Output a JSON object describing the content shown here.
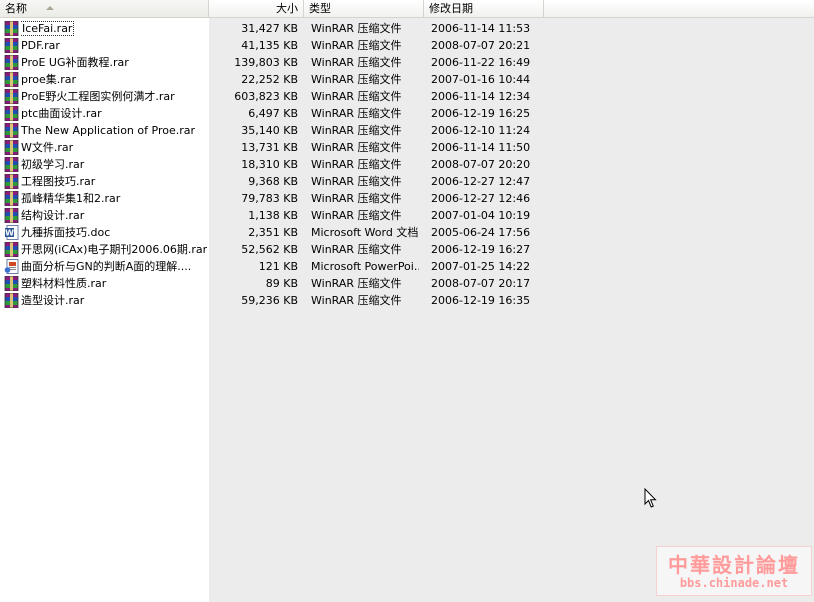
{
  "columns": {
    "name": "名称",
    "size": "大小",
    "type": "类型",
    "modified": "修改日期"
  },
  "files": [
    {
      "icon": "winrar-icon",
      "name": "IceFai.rar",
      "size": "31,427 KB",
      "type": "WinRAR 压缩文件",
      "modified": "2006-11-14 11:53",
      "selected": true
    },
    {
      "icon": "winrar-icon",
      "name": "PDF.rar",
      "size": "41,135 KB",
      "type": "WinRAR 压缩文件",
      "modified": "2008-07-07 20:21"
    },
    {
      "icon": "winrar-icon",
      "name": "ProE UG补面教程.rar",
      "size": "139,803 KB",
      "type": "WinRAR 压缩文件",
      "modified": "2006-11-22 16:49"
    },
    {
      "icon": "winrar-icon",
      "name": "proe集.rar",
      "size": "22,252 KB",
      "type": "WinRAR 压缩文件",
      "modified": "2007-01-16 10:44"
    },
    {
      "icon": "winrar-icon",
      "name": "ProE野火工程图实例何满才.rar",
      "size": "603,823 KB",
      "type": "WinRAR 压缩文件",
      "modified": "2006-11-14 12:34"
    },
    {
      "icon": "winrar-icon",
      "name": "ptc曲面设计.rar",
      "size": "6,497 KB",
      "type": "WinRAR 压缩文件",
      "modified": "2006-12-19 16:25"
    },
    {
      "icon": "winrar-icon",
      "name": "The New Application of Proe.rar",
      "size": "35,140 KB",
      "type": "WinRAR 压缩文件",
      "modified": "2006-12-10 11:24"
    },
    {
      "icon": "winrar-icon",
      "name": "W文件.rar",
      "size": "13,731 KB",
      "type": "WinRAR 压缩文件",
      "modified": "2006-11-14 11:50"
    },
    {
      "icon": "winrar-icon",
      "name": "初级学习.rar",
      "size": "18,310 KB",
      "type": "WinRAR 压缩文件",
      "modified": "2008-07-07 20:20"
    },
    {
      "icon": "winrar-icon",
      "name": "工程图技巧.rar",
      "size": "9,368 KB",
      "type": "WinRAR 压缩文件",
      "modified": "2006-12-27 12:47"
    },
    {
      "icon": "winrar-icon",
      "name": "孤峰精华集1和2.rar",
      "size": "79,783 KB",
      "type": "WinRAR 压缩文件",
      "modified": "2006-12-27 12:46"
    },
    {
      "icon": "winrar-icon",
      "name": "结构设计.rar",
      "size": "1,138 KB",
      "type": "WinRAR 压缩文件",
      "modified": "2007-01-04 10:19"
    },
    {
      "icon": "word-doc-icon",
      "name": "九種拆面技巧.doc",
      "size": "2,351 KB",
      "type": "Microsoft Word 文档",
      "modified": "2005-06-24 17:56"
    },
    {
      "icon": "winrar-icon",
      "name": "开思网(iCAx)电子期刊2006.06期.rar",
      "size": "52,562 KB",
      "type": "WinRAR 压缩文件",
      "modified": "2006-12-19 16:27"
    },
    {
      "icon": "powerpoint-icon",
      "name": "曲面分析与GN的判断A面的理解....",
      "size": "121 KB",
      "type": "Microsoft PowerPoi...",
      "modified": "2007-01-25 14:22"
    },
    {
      "icon": "winrar-icon",
      "name": "塑料材料性质.rar",
      "size": "89 KB",
      "type": "WinRAR 压缩文件",
      "modified": "2008-07-07 20:17"
    },
    {
      "icon": "winrar-icon",
      "name": "造型设计.rar",
      "size": "59,236 KB",
      "type": "WinRAR 压缩文件",
      "modified": "2006-12-19 16:35"
    }
  ],
  "watermark": {
    "title": "中華設計論壇",
    "url": "bbs.chinade.net"
  },
  "colors": {
    "header_bg": "#f1f1ef",
    "name_column_bg": "#ffffff",
    "list_bg": "#ececec",
    "watermark": "#ff9b9b"
  }
}
